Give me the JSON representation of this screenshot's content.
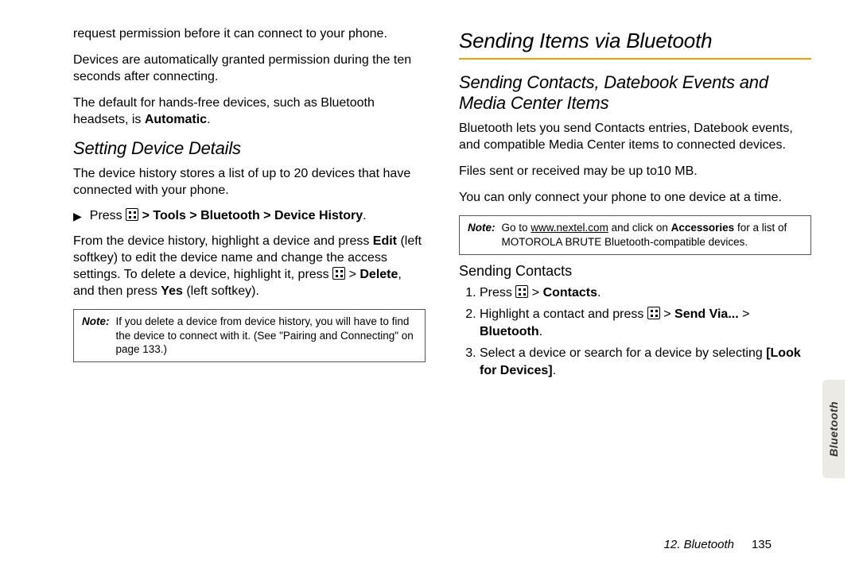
{
  "left": {
    "p1": "request permission before it can connect to your phone.",
    "p2": "Devices are automatically granted permission during the ten seconds after connecting.",
    "p3_a": "The default for hands-free devices, such as Bluetooth headsets, is ",
    "p3_b": "Automatic",
    "p3_c": ".",
    "h2": "Setting Device Details",
    "p4": "The device history stores a list of up to 20 devices that have connected with your phone.",
    "step_press": "Press ",
    "step_path": " > Tools > Bluetooth > Device History",
    "step_end": ".",
    "p5_a": "From the device history, highlight a device and press ",
    "p5_b": "Edit",
    "p5_c": " (left softkey) to edit the device name and change the access settings. To delete a device, highlight it, press ",
    "p5_d": " > ",
    "p5_e": "Delete",
    "p5_f": ", and then press ",
    "p5_g": "Yes",
    "p5_h": " (left softkey).",
    "note_label": "Note:",
    "note_body": "If you delete a device from device history, you will have to find the device to connect with it. (See \"Pairing and Connecting\" on page 133.)"
  },
  "right": {
    "h1": "Sending Items via Bluetooth",
    "h2": "Sending Contacts, Datebook Events and Media Center Items",
    "p1": "Bluetooth lets you send Contacts entries, Datebook events, and compatible Media Center items to connected devices.",
    "p2": "Files sent or received may be up to10 MB.",
    "p3": "You can only connect your phone to one device at a time.",
    "note_label": "Note:",
    "note_a": "Go to ",
    "note_url": "www.nextel.com",
    "note_b": " and click on ",
    "note_bold": "Accessories",
    "note_c": " for a list of MOTOROLA BRUTE Bluetooth-compatible devices.",
    "h3": "Sending Contacts",
    "s1_a": "Press ",
    "s1_b": " > ",
    "s1_c": "Contacts",
    "s1_d": ".",
    "s2_a": "Highlight a contact and press ",
    "s2_b": " > ",
    "s2_c": "Send Via...",
    "s2_d": " > ",
    "s2_e": "Bluetooth",
    "s2_f": ".",
    "s3_a": "Select a device or search for a device by selecting ",
    "s3_b": "[Look for Devices]",
    "s3_c": "."
  },
  "footer": {
    "chapter": "12. Bluetooth",
    "page": "135"
  },
  "tab": "Bluetooth"
}
